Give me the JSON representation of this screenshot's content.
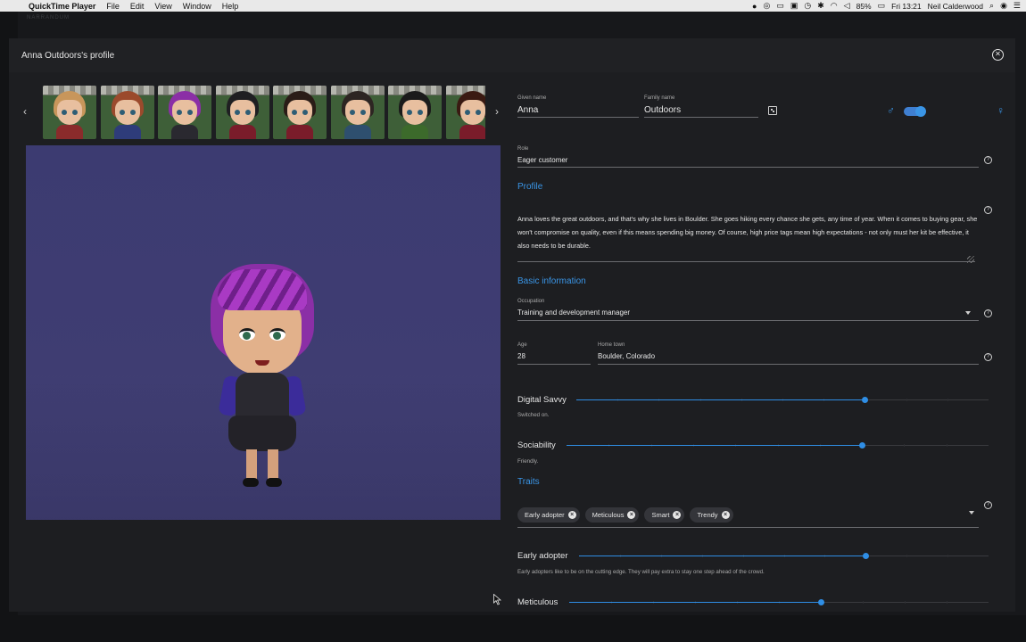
{
  "menubar": {
    "app_name": "QuickTime Player",
    "menus": [
      "File",
      "Edit",
      "View",
      "Window",
      "Help"
    ],
    "battery": "85%",
    "clock": "Fri 13:21",
    "user": "Neil Calderwood"
  },
  "background": {
    "brand": "NARRANDUM"
  },
  "modal": {
    "title": "Anna Outdoors's profile"
  },
  "avatars": [
    {
      "hair": "#c8965b",
      "body": "#8a2b2b"
    },
    {
      "hair": "#9b4a2c",
      "body": "#2e3c7a"
    },
    {
      "hair": "#8b2fa6",
      "body": "#2a2930"
    },
    {
      "hair": "#1f1f22",
      "body": "#7a1c2a"
    },
    {
      "hair": "#2a1c17",
      "body": "#7a1c2a"
    },
    {
      "hair": "#2d2522",
      "body": "#2e4f6e"
    },
    {
      "hair": "#1b1b1b",
      "body": "#3c6a2b"
    },
    {
      "hair": "#3a1a12",
      "body": "#7a1c2a"
    }
  ],
  "form": {
    "given_name_label": "Given name",
    "given_name": "Anna",
    "family_name_label": "Family name",
    "family_name": "Outdoors",
    "role_label": "Role",
    "role": "Eager customer",
    "profile_section": "Profile",
    "profile_text": "Anna loves the great outdoors, and that's why she lives in Boulder. She goes hiking every chance she gets, any time of year. When it comes to buying gear, she won't compromise on quality, even if this means spending big money. Of course, high price tags mean high expectations - not only must her kit be effective, it also needs to be durable.",
    "basic_section": "Basic information",
    "occupation_label": "Occupation",
    "occupation": "Training and development manager",
    "age_label": "Age",
    "age": "28",
    "hometown_label": "Home town",
    "hometown": "Boulder, Colorado",
    "traits_section": "Traits"
  },
  "sliders": {
    "digital_savvy": {
      "label": "Digital Savvy",
      "desc": "Switched on.",
      "value": 0.7
    },
    "sociability": {
      "label": "Sociability",
      "desc": "Friendly.",
      "value": 0.7
    },
    "early_adopter": {
      "label": "Early adopter",
      "desc": "Early adopters like to be on the cutting edge. They will pay extra to stay one step ahead of the crowd.",
      "value": 0.7
    },
    "meticulous": {
      "label": "Meticulous",
      "value": 0.6
    }
  },
  "traits": [
    "Early adopter",
    "Meticulous",
    "Smart",
    "Trendy"
  ],
  "colors": {
    "accent": "#3a95e6",
    "panel": "#1d1e21"
  }
}
